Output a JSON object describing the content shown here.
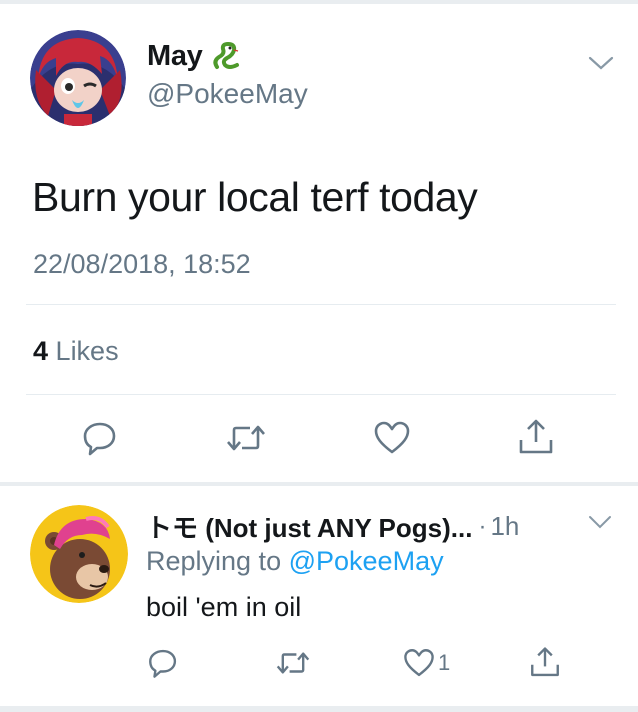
{
  "main_tweet": {
    "display_name": "May",
    "badge_emoji": "snake-emoji",
    "handle": "@PokeeMay",
    "text": "Burn your local terf today",
    "timestamp": "22/08/2018, 18:52",
    "likes_count": "4",
    "likes_label": "Likes",
    "actions": [
      "reply-icon",
      "retweet-icon",
      "like-icon",
      "share-icon"
    ]
  },
  "reply": {
    "display_name": "トモ (Not just ANY Pogs)...",
    "separator": "·",
    "time": "1h",
    "replying_prefix": "Replying to",
    "replying_to": "@PokeeMay",
    "text": "boil 'em in oil",
    "like_count": "1",
    "actions": [
      "reply-icon",
      "retweet-icon",
      "like-icon",
      "share-icon"
    ]
  },
  "colors": {
    "text": "#14171a",
    "muted": "#657786",
    "link": "#1da1f2",
    "divider": "#e6ecf0"
  }
}
